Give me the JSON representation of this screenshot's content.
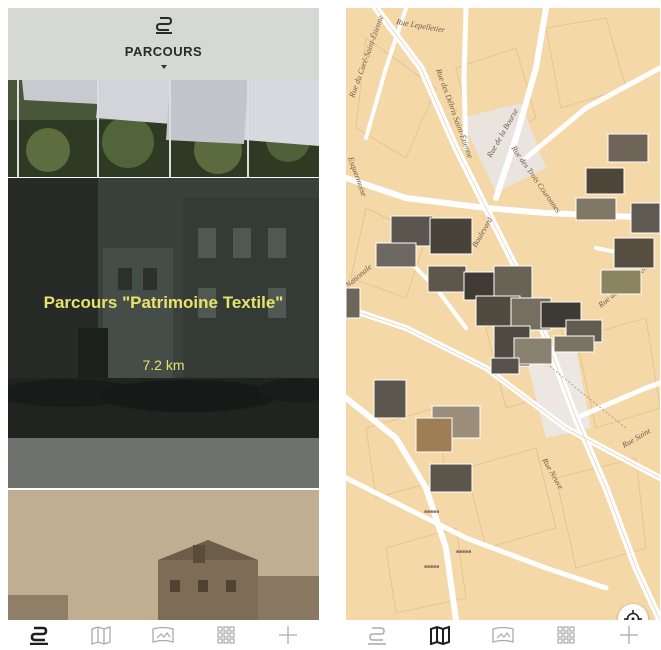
{
  "left_screen": {
    "header": {
      "title": "PARCOURS",
      "icon": "route-icon"
    },
    "cards": [
      {
        "id": "flags",
        "title": "",
        "distance": ""
      },
      {
        "id": "textile",
        "title": "Parcours \"Patrimoine Textile\"",
        "distance": "7.2 km"
      },
      {
        "id": "street",
        "title": "",
        "distance": ""
      }
    ],
    "nav": [
      {
        "name": "route",
        "icon": "route-icon",
        "active": true
      },
      {
        "name": "map",
        "icon": "map-icon",
        "active": false
      },
      {
        "name": "panorama",
        "icon": "panorama-icon",
        "active": false
      },
      {
        "name": "grid",
        "icon": "grid-icon",
        "active": false
      },
      {
        "name": "add",
        "icon": "plus-icon",
        "active": false
      }
    ]
  },
  "right_screen": {
    "street_labels": [
      "Rue du Curé-Saint-Étienne",
      "Rue Lepelletier",
      "Rue des Débris Saint-Étienne",
      "Rue de la Bourse",
      "Rue des Trois Couronnes",
      "Nationale",
      "Rue Neuve",
      "Rue Saint",
      "Rue des Manneliers",
      "Esquermoise",
      "Boulevard"
    ],
    "nav": [
      {
        "name": "route",
        "icon": "route-icon",
        "active": false
      },
      {
        "name": "map",
        "icon": "map-icon",
        "active": true
      },
      {
        "name": "panorama",
        "icon": "panorama-icon",
        "active": false
      },
      {
        "name": "grid",
        "icon": "grid-icon",
        "active": false
      },
      {
        "name": "add",
        "icon": "plus-icon",
        "active": false
      }
    ],
    "locate_icon": "crosshair-icon"
  },
  "colors": {
    "header_bg": "#d5d8d3",
    "title_yellow": "#e8e36a",
    "map_bg": "#f4d8a8",
    "road": "#ffffff"
  }
}
